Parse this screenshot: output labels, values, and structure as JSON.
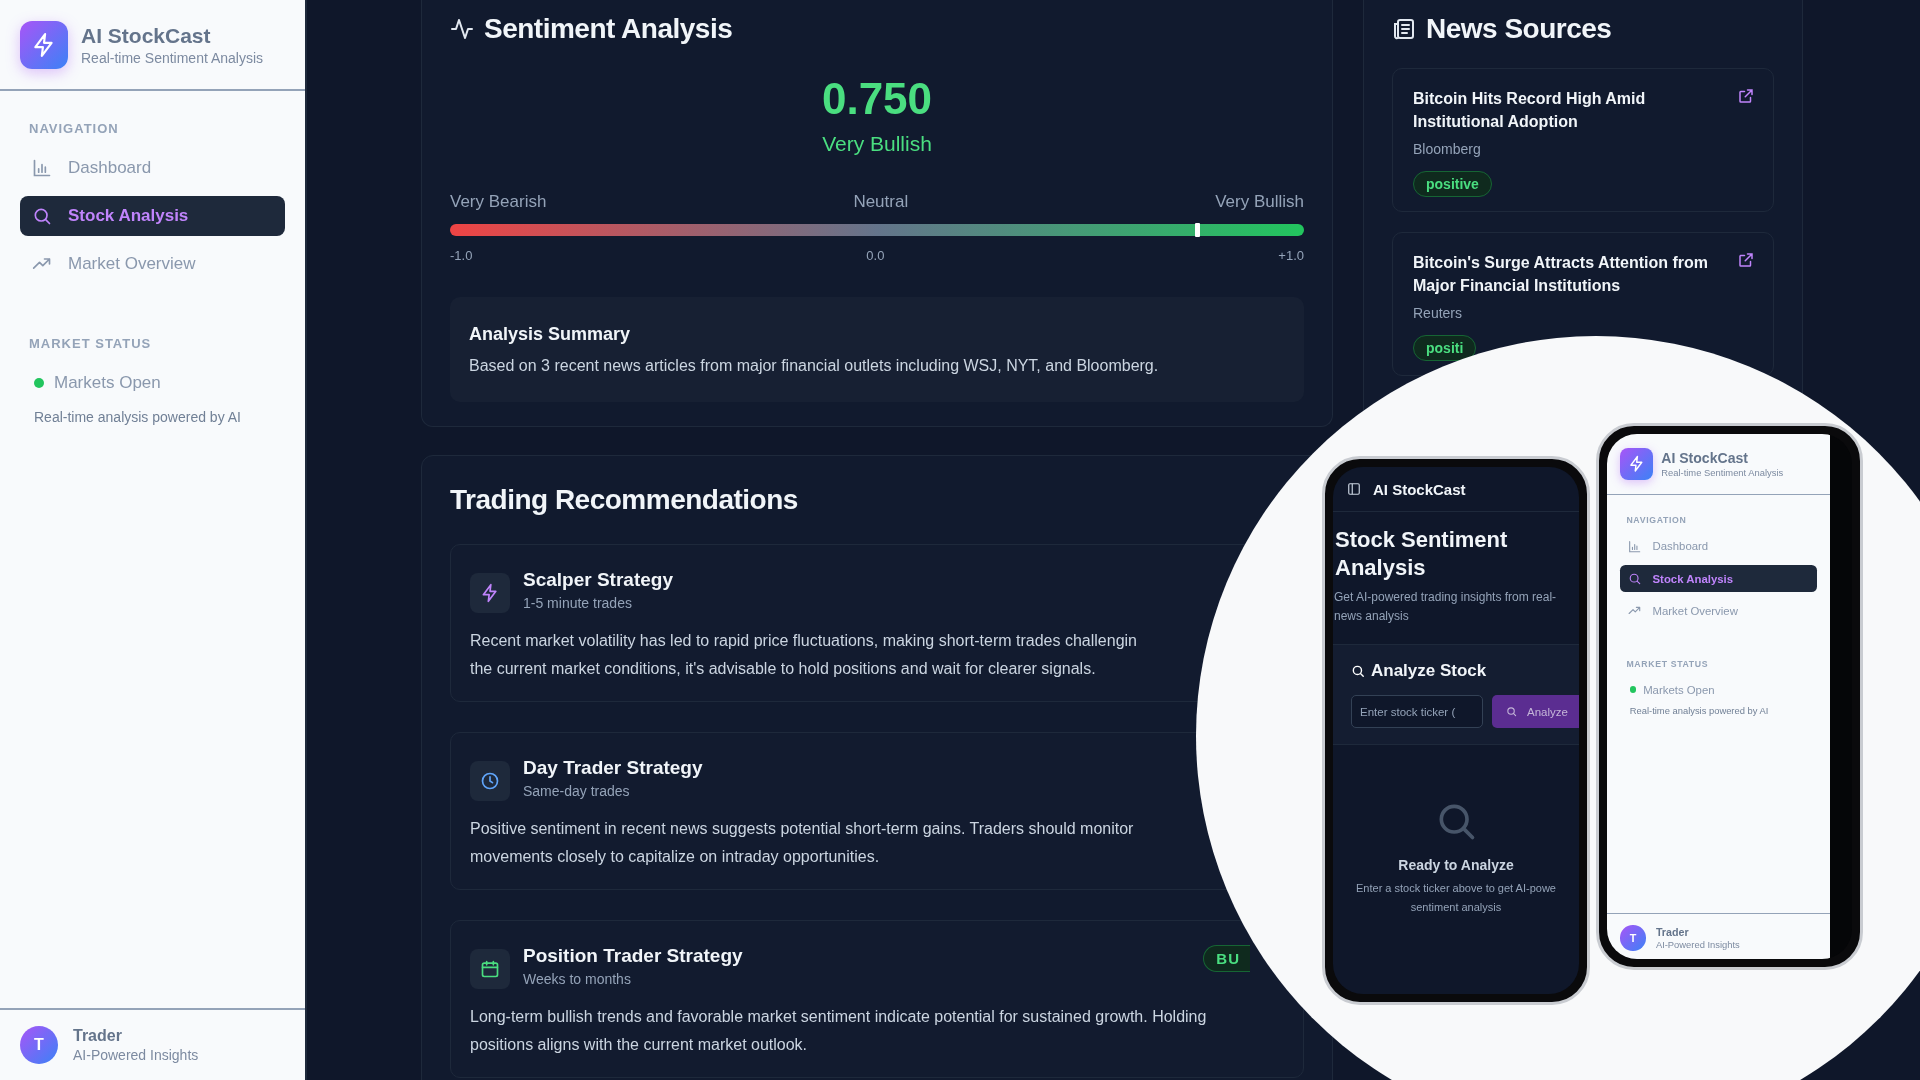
{
  "sidebar": {
    "app_name": "AI StockCast",
    "tagline": "Real-time Sentiment Analysis",
    "nav_heading": "NAVIGATION",
    "nav_items": [
      {
        "label": "Dashboard",
        "kind": "chart",
        "selected": false
      },
      {
        "label": "Stock Analysis",
        "kind": "search",
        "selected": true
      },
      {
        "label": "Market Overview",
        "kind": "trend",
        "selected": false
      }
    ],
    "status_heading": "MARKET STATUS",
    "market_status": {
      "label": "Markets Open",
      "open": true
    },
    "note": "Real-time analysis powered by AI",
    "user": {
      "initial": "T",
      "name": "Trader",
      "role": "AI-Powered Insights"
    }
  },
  "sentiment": {
    "title": "Sentiment Analysis",
    "score": "0.750",
    "label": "Very Bullish",
    "scale_labels": [
      "Very Bearish",
      "Neutral",
      "Very Bullish"
    ],
    "level": 0.875,
    "ticks": [
      "-1.0",
      "0.0",
      "+1.0"
    ],
    "summary": {
      "title": "Analysis Summary",
      "text": "Based on 3 recent news articles from major financial outlets including WSJ, NYT, and Bloomberg."
    }
  },
  "trading": {
    "title": "Trading Recommendations",
    "strategies": [
      {
        "name": "Scalper Strategy",
        "timeframe": "1-5 minute trades",
        "kind": "bolt",
        "description_lines": [
          "Recent market volatility has led to rapid price fluctuations, making short-term trades challengin",
          "the current market conditions, it's advisable to hold positions and wait for clearer signals."
        ]
      },
      {
        "name": "Day Trader Strategy",
        "timeframe": "Same-day trades",
        "kind": "clock",
        "description_lines": [
          "Positive sentiment in recent news suggests potential short-term gains. Traders should monitor",
          "movements closely to capitalize on intraday opportunities."
        ]
      },
      {
        "name": "Position Trader Strategy",
        "timeframe": "Weeks to months",
        "kind": "calendar",
        "signal": "BU",
        "description_lines": [
          "Long-term bullish trends and favorable market sentiment indicate potential for sustained growth. Holding",
          "positions aligns with the current market outlook."
        ]
      }
    ]
  },
  "news": {
    "title": "News Sources",
    "articles": [
      {
        "headline": "Bitcoin Hits Record High Amid Institutional Adoption",
        "source": "Bloomberg",
        "sentiment": "positive"
      },
      {
        "headline": "Bitcoin's Surge Attracts Attention from Major Financial Institutions",
        "source": "Reuters",
        "sentiment": "positi"
      }
    ]
  },
  "mobile_main": {
    "app_name": "AI StockCast",
    "title": "Stock Sentiment Analysis",
    "subtitle": "Get AI-powered trading insights from real-news analysis",
    "analyze_title": "Analyze Stock",
    "input_placeholder": "Enter stock ticker (",
    "analyze_button": "Analyze",
    "empty_title": "Ready to Analyze",
    "empty_text": "Enter a stock ticker above to get AI-powe sentiment analysis"
  },
  "mobile_sidebar": {
    "app_name": "AI StockCast",
    "tagline": "Real-time Sentiment Analysis",
    "nav_heading": "NAVIGATION",
    "nav_items": [
      {
        "label": "Dashboard",
        "kind": "chart",
        "selected": false
      },
      {
        "label": "Stock Analysis",
        "kind": "search",
        "selected": true
      },
      {
        "label": "Market Overview",
        "kind": "trend",
        "selected": false
      }
    ],
    "status_heading": "MARKET STATUS",
    "market_status": {
      "label": "Markets Open",
      "open": true
    },
    "note": "Real-time analysis powered by AI",
    "user": {
      "initial": "T",
      "name": "Trader",
      "role": "AI-Powered Insights"
    }
  }
}
